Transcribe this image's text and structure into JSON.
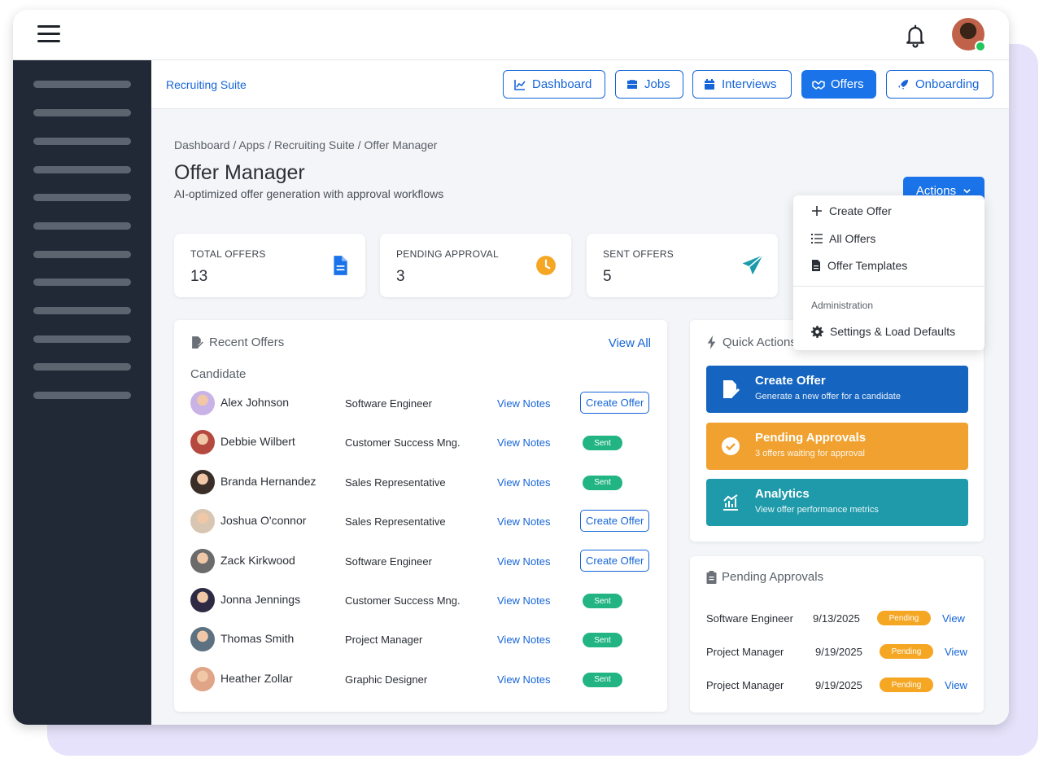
{
  "topbar": {
    "menu_icon": "hamburger-icon",
    "bell_icon": "bell-icon",
    "avatar": "user-avatar"
  },
  "subnav": {
    "brand": "Recruiting Suite",
    "tabs": [
      {
        "label": "Dashboard",
        "icon": "chart-icon"
      },
      {
        "label": "Jobs",
        "icon": "briefcase-icon"
      },
      {
        "label": "Interviews",
        "icon": "calendar-icon"
      },
      {
        "label": "Offers",
        "icon": "handshake-icon",
        "active": true
      },
      {
        "label": "Onboarding",
        "icon": "rocket-icon"
      }
    ]
  },
  "breadcrumb": "Dashboard / Apps / Recruiting Suite / Offer Manager",
  "page": {
    "title": "Offer Manager",
    "subtitle": "AI-optimized offer generation with approval workflows",
    "actions_label": "Actions"
  },
  "stats": [
    {
      "label": "TOTAL OFFERS",
      "value": "13",
      "icon": "document-icon",
      "color": "#1a73e8"
    },
    {
      "label": "PENDING APPROVAL",
      "value": "3",
      "icon": "clock-icon",
      "color": "#f5a623"
    },
    {
      "label": "SENT OFFERS",
      "value": "5",
      "icon": "paper-plane-icon",
      "color": "#1a9bab"
    }
  ],
  "recent_offers": {
    "title": "Recent Offers",
    "view_all": "View All",
    "column_header": "Candidate",
    "rows": [
      {
        "name": "Alex Johnson",
        "role": "Software Engineer",
        "notes": "View Notes",
        "action": "Create Offer",
        "status": "",
        "avatar_color": "#c9b3e6"
      },
      {
        "name": "Debbie Wilbert",
        "role": "Customer Success Mng.",
        "notes": "View Notes",
        "action": "",
        "status": "Sent",
        "avatar_color": "#b5493f"
      },
      {
        "name": "Branda Hernandez",
        "role": "Sales Representative",
        "notes": "View Notes",
        "action": "",
        "status": "Sent",
        "avatar_color": "#3a2e28"
      },
      {
        "name": "Joshua O'connor",
        "role": "Sales Representative",
        "notes": "View Notes",
        "action": "Create Offer",
        "status": "",
        "avatar_color": "#d8c6b3"
      },
      {
        "name": "Zack Kirkwood",
        "role": "Software Engineer",
        "notes": "View Notes",
        "action": "Create Offer",
        "status": "",
        "avatar_color": "#6b6b6b"
      },
      {
        "name": "Jonna Jennings",
        "role": "Customer Success Mng.",
        "notes": "View Notes",
        "action": "",
        "status": "Sent",
        "avatar_color": "#2f2a44"
      },
      {
        "name": "Thomas Smith",
        "role": "Project Manager",
        "notes": "View Notes",
        "action": "",
        "status": "Sent",
        "avatar_color": "#5d7180"
      },
      {
        "name": "Heather Zollar",
        "role": "Graphic Designer",
        "notes": "View Notes",
        "action": "",
        "status": "Sent",
        "avatar_color": "#e0a486"
      }
    ]
  },
  "quick_actions": {
    "title": "Quick Actions",
    "items": [
      {
        "title": "Create Offer",
        "subtitle": "Generate a new offer for a candidate",
        "color": "#1565c0",
        "icon": "file-signature-icon"
      },
      {
        "title": "Pending Approvals",
        "subtitle": "3 offers waiting for approval",
        "color": "#f0a12f",
        "icon": "check-circle-icon"
      },
      {
        "title": "Analytics",
        "subtitle": "View offer performance metrics",
        "color": "#1e9aab",
        "icon": "analytics-icon"
      }
    ]
  },
  "pending_approvals": {
    "title": "Pending Approvals",
    "rows": [
      {
        "role": "Software Engineer",
        "date": "9/13/2025",
        "status": "Pending",
        "link": "View"
      },
      {
        "role": "Project Manager",
        "date": "9/19/2025",
        "status": "Pending",
        "link": "View"
      },
      {
        "role": "Project Manager",
        "date": "9/19/2025",
        "status": "Pending",
        "link": "View"
      }
    ]
  },
  "actions_menu": {
    "items": [
      {
        "label": "Create Offer",
        "icon": "plus-icon"
      },
      {
        "label": "All Offers",
        "icon": "list-icon"
      },
      {
        "label": "Offer Templates",
        "icon": "file-icon"
      }
    ],
    "section_header": "Administration",
    "admin_items": [
      {
        "label": "Settings & Load Defaults",
        "icon": "gear-icon"
      }
    ]
  }
}
